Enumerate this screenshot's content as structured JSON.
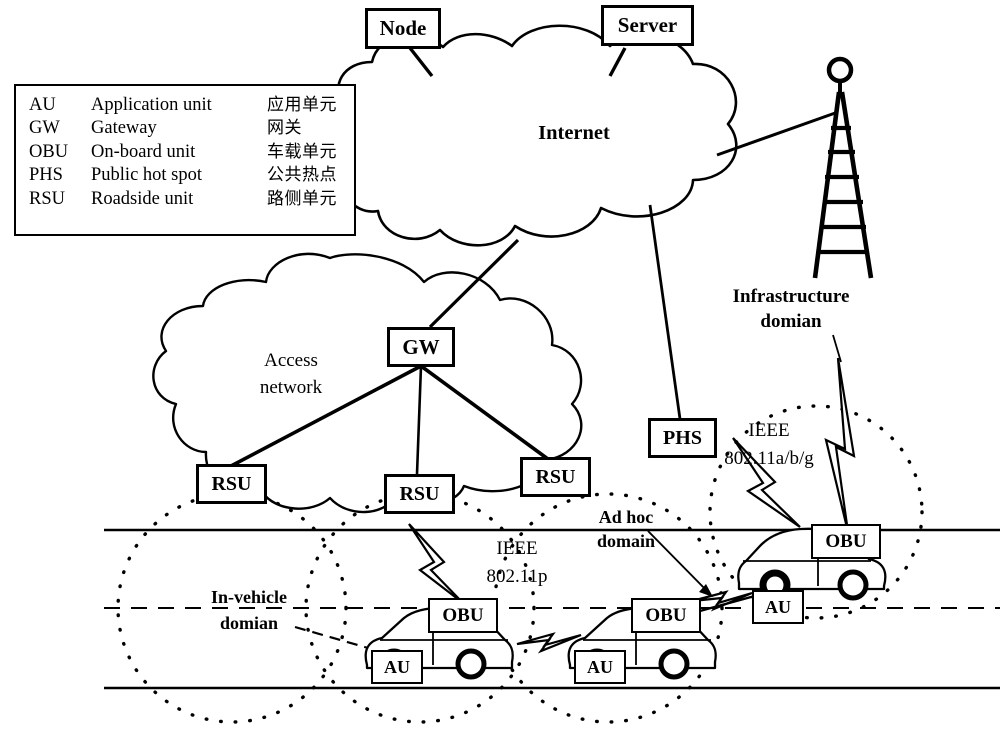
{
  "diagram": {
    "title_alt": "VANET architecture diagram",
    "legend": {
      "rows": [
        {
          "abbr": "AU",
          "english": "Application unit",
          "chinese": "应用单元"
        },
        {
          "abbr": "GW",
          "english": "Gateway",
          "chinese": "网关"
        },
        {
          "abbr": "OBU",
          "english": "On-board unit",
          "chinese": "车载单元"
        },
        {
          "abbr": "PHS",
          "english": "Public hot spot",
          "chinese": "公共热点"
        },
        {
          "abbr": "RSU",
          "english": "Roadside unit",
          "chinese": "路侧单元"
        }
      ]
    },
    "nodes": {
      "node": "Node",
      "server": "Server",
      "internet": "Internet",
      "gateway": "GW",
      "phs": "PHS",
      "rsu_left": "RSU",
      "rsu_center": "RSU",
      "rsu_right": "RSU",
      "obu_car1": "OBU",
      "obu_car2": "OBU",
      "obu_car3": "OBU",
      "au_car1": "AU",
      "au_car2": "AU",
      "au_car3": "AU"
    },
    "clouds": {
      "internet_label": "Internet",
      "access_network_label_line1": "Access",
      "access_network_label_line2": "network"
    },
    "domains": {
      "infrastructure_line1": "Infrastructure",
      "infrastructure_line2": "domian",
      "adhoc_line1": "Ad hoc",
      "adhoc_line2": "domain",
      "invehicle_line1": "In-vehicle",
      "invehicle_line2": "domian"
    },
    "standards": {
      "wifi_line1": "IEEE",
      "wifi_line2": "802.11a/b/g",
      "wave_line1": "IEEE",
      "wave_line2": "802.11p"
    },
    "colors": {
      "stroke": "#000000",
      "background": "#ffffff"
    }
  }
}
